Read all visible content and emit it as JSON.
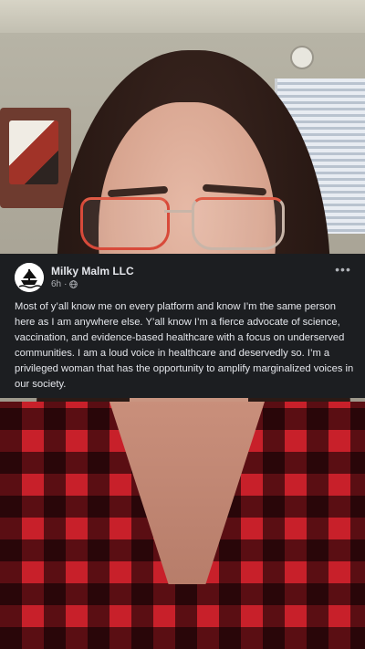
{
  "post": {
    "author": "Milky Malm LLC",
    "timestamp": "6h",
    "separator": "·",
    "audience_icon": "globe-icon",
    "avatar_icon": "ship-logo-icon",
    "more_icon": "more-options-icon",
    "more_label": "•••",
    "text": "Most of y’all know me on every platform and know I’m the same person here as I am anywhere else. Y’all know I’m a fierce advocate of science, vaccination, and evidence-based healthcare with a focus on underserved communities. I am a loud voice in healthcare and deservedly so. I’m a privileged woman that has the opportunity to amplify marginalized voices in our society."
  },
  "colors": {
    "post_background": "#1c1e21",
    "primary_text": "#e4e6eb",
    "secondary_text": "#b0b3b8",
    "shirt_red": "#c8202a",
    "glasses_red": "#d84a3a"
  }
}
